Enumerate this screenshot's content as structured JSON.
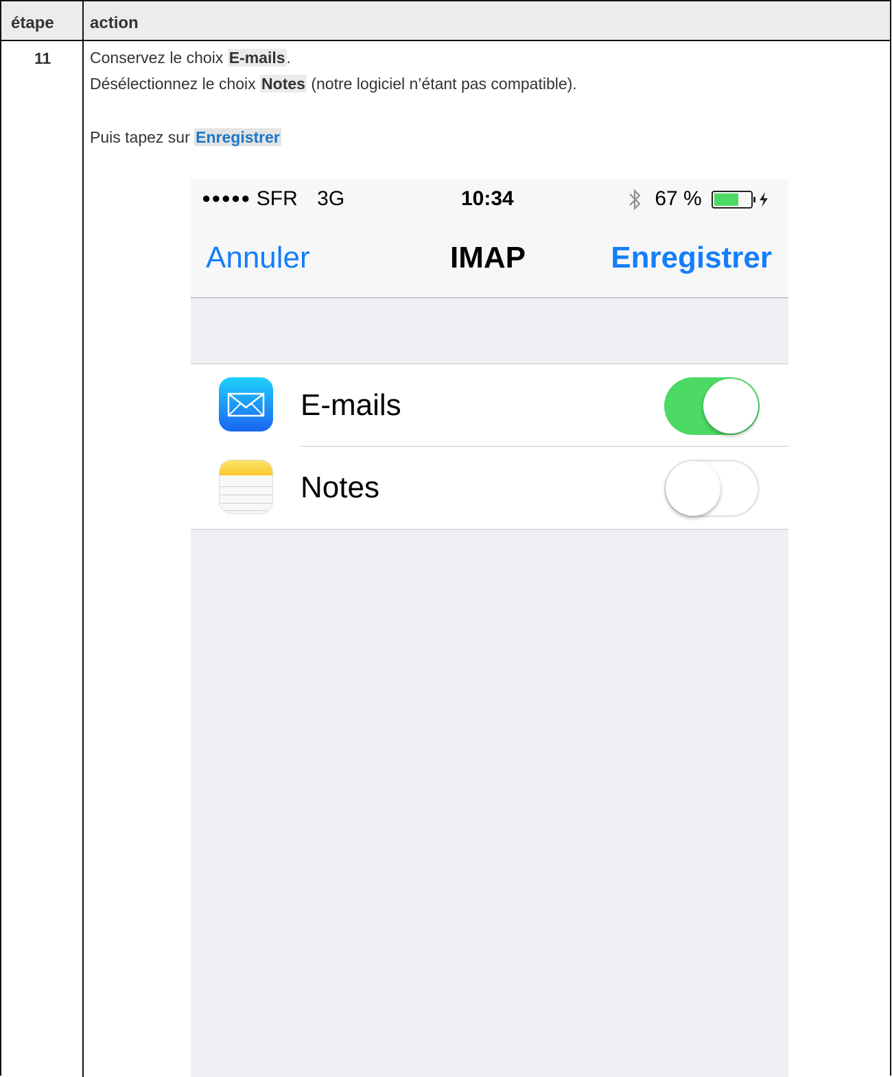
{
  "table": {
    "col_step": "étape",
    "col_action": "action",
    "step_number": "11"
  },
  "instructions": {
    "line1_prefix": "Conservez le choix ",
    "line1_bold": "E-mails",
    "line1_suffix": ".",
    "line2_prefix": "Désélectionnez le choix ",
    "line2_bold": "Notes",
    "line2_suffix": " (notre logiciel n’étant pas compatible).",
    "line3_prefix": "Puis tapez sur ",
    "line3_bold": "Enregistrer"
  },
  "phone": {
    "status": {
      "signal": "●●●●●",
      "carrier": "SFR",
      "network": "3G",
      "time": "10:34",
      "battery_text": "67 %",
      "battery_level": 0.67
    },
    "nav": {
      "cancel": "Annuler",
      "title": "IMAP",
      "save": "Enregistrer"
    },
    "rows": [
      {
        "label": "E-mails",
        "icon": "mail-icon",
        "enabled": true
      },
      {
        "label": "Notes",
        "icon": "notes-icon",
        "enabled": false
      }
    ]
  },
  "colors": {
    "ios_blue": "#147efb",
    "toggle_green": "#4cd964",
    "highlight_blue": "#1a78c8"
  }
}
